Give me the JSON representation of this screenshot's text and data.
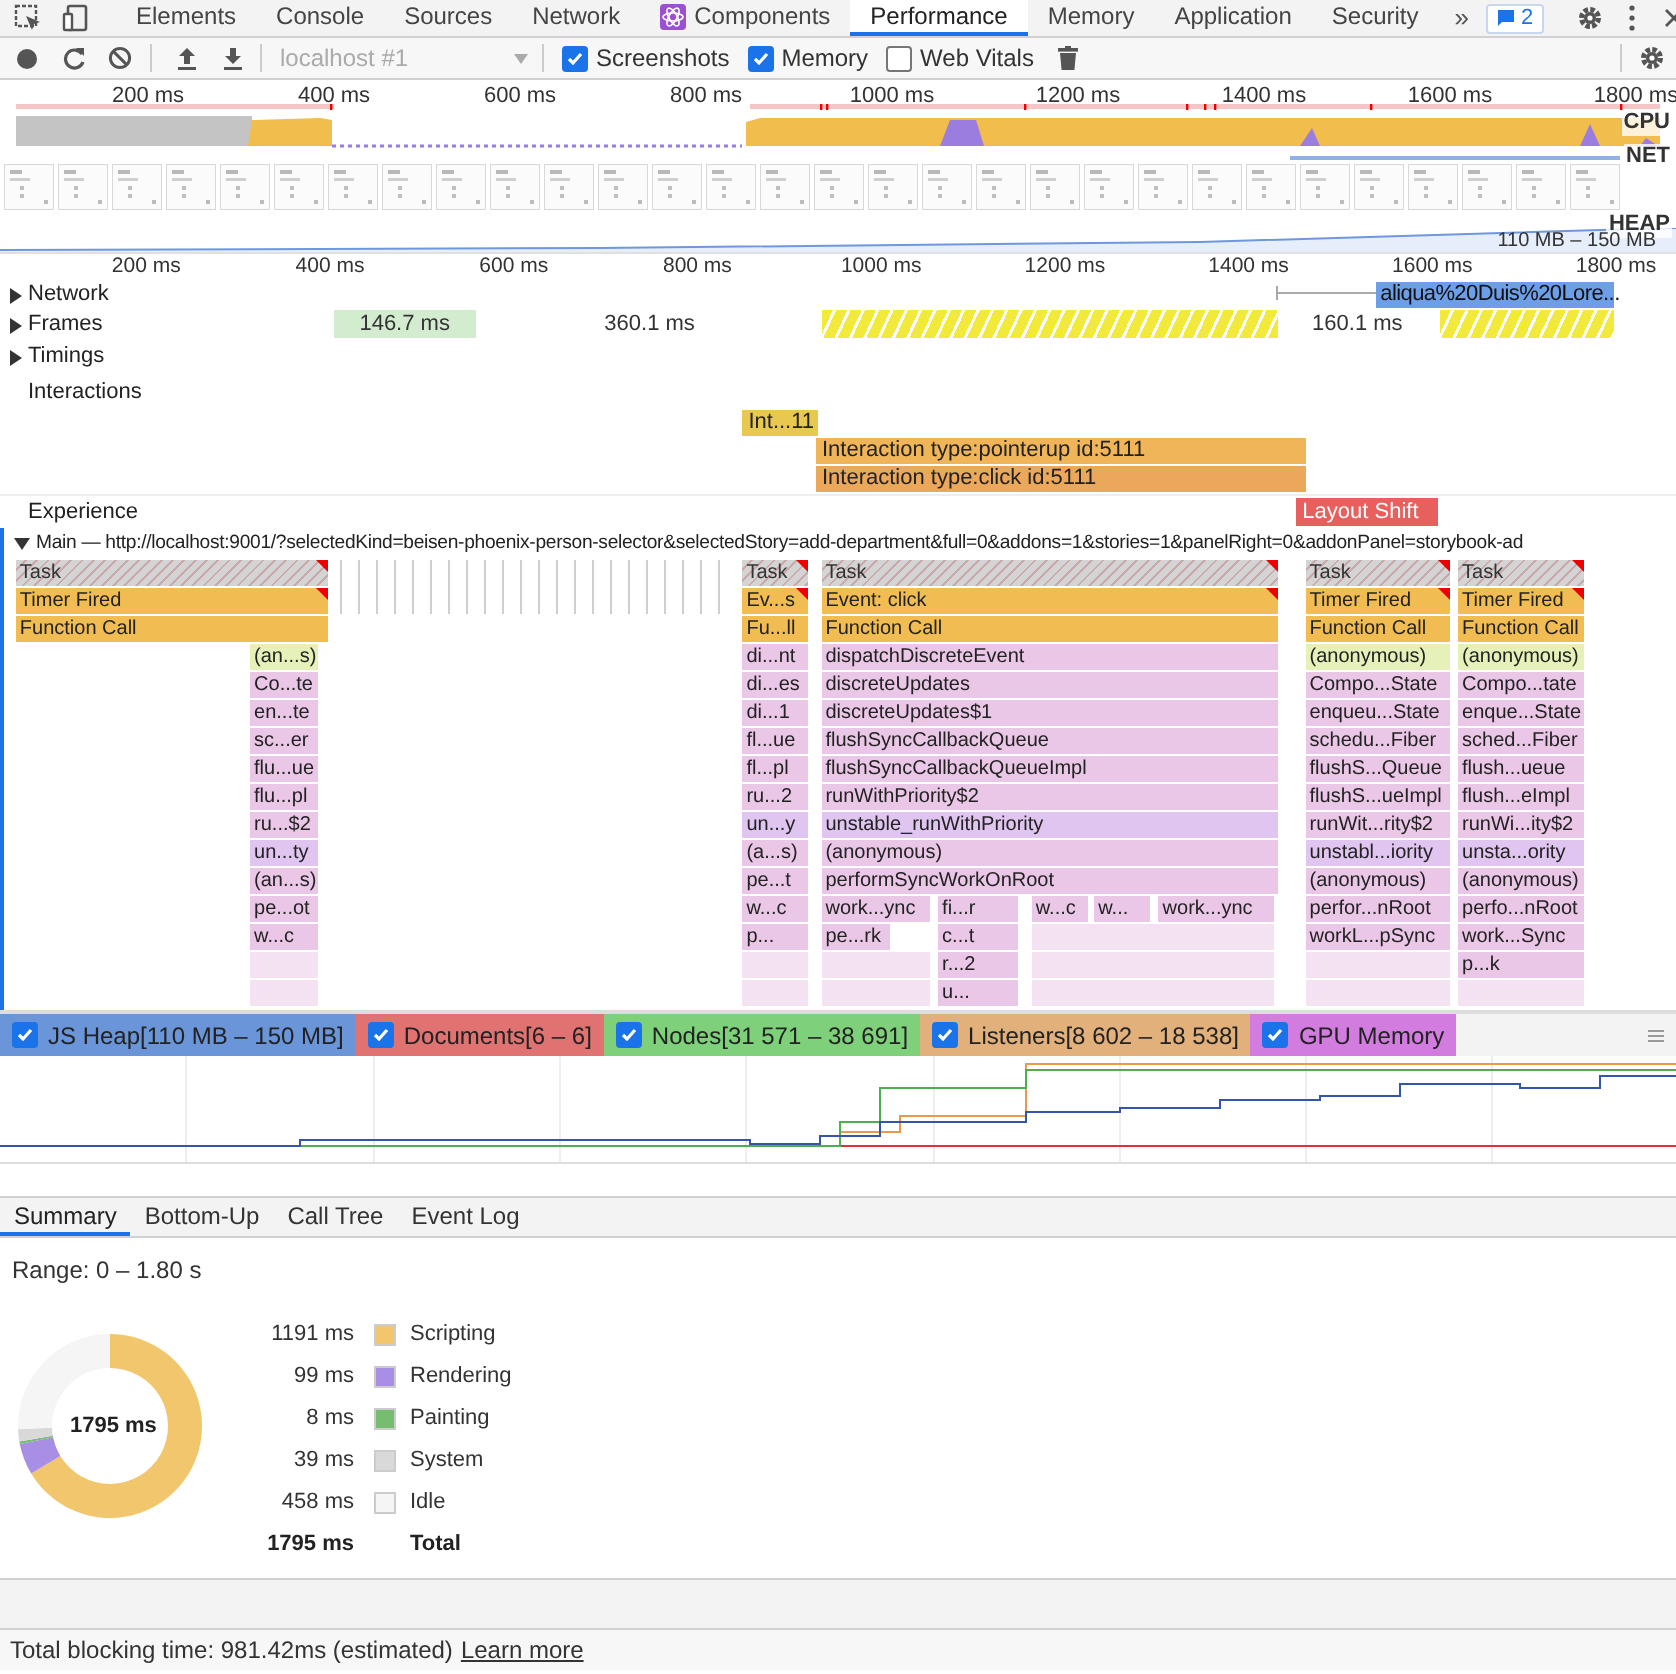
{
  "tabs": [
    {
      "label": "Elements",
      "selected": false,
      "kind": "plain"
    },
    {
      "label": "Console",
      "selected": false,
      "kind": "plain"
    },
    {
      "label": "Sources",
      "selected": false,
      "kind": "plain"
    },
    {
      "label": "Network",
      "selected": false,
      "kind": "plain"
    },
    {
      "label": "Components",
      "selected": false,
      "kind": "icon"
    },
    {
      "label": "Performance",
      "selected": true,
      "kind": "plain"
    },
    {
      "label": "Memory",
      "selected": false,
      "kind": "plain"
    },
    {
      "label": "Application",
      "selected": false,
      "kind": "plain"
    },
    {
      "label": "Security",
      "selected": false,
      "kind": "plain"
    }
  ],
  "overflow": "»",
  "issues_badge": "2",
  "toolbar": {
    "target": "localhost #1",
    "checkboxes": [
      {
        "label": "Screenshots",
        "checked": true
      },
      {
        "label": "Memory",
        "checked": true
      },
      {
        "label": "Web Vitals",
        "checked": false
      }
    ]
  },
  "overview": {
    "ticks": [
      "200 ms",
      "400 ms",
      "600 ms",
      "800 ms",
      "1000 ms",
      "1200 ms",
      "1400 ms",
      "1600 ms",
      "1800 ms"
    ],
    "lanes": [
      "CPU",
      "NET",
      "HEAP"
    ],
    "heap_range": "110 MB – 150 MB",
    "filmstrip": [
      {
        "kind": "picture"
      },
      {
        "kind": "picture"
      },
      {
        "kind": "picture"
      },
      {
        "kind": "picture"
      },
      {
        "kind": "picture"
      },
      {
        "kind": "picture"
      },
      {
        "kind": "picture"
      },
      {
        "kind": "picture"
      },
      {
        "kind": "picture"
      },
      {
        "kind": "picture"
      },
      {
        "kind": "picture"
      },
      {
        "kind": "picture"
      },
      {
        "kind": "picture"
      },
      {
        "kind": "picture"
      },
      {
        "kind": "picture"
      },
      {
        "kind": "picture"
      },
      {
        "kind": "picture"
      },
      {
        "kind": "picture"
      },
      {
        "kind": "picture"
      },
      {
        "kind": "picture"
      },
      {
        "kind": "picture"
      },
      {
        "kind": "picture"
      },
      {
        "kind": "picture"
      },
      {
        "kind": "picture"
      },
      {
        "kind": "picture"
      },
      {
        "kind": "picture"
      },
      {
        "kind": "picture"
      },
      {
        "kind": "picture"
      },
      {
        "kind": "picture"
      },
      {
        "kind": "picture"
      }
    ]
  },
  "ruler": [
    "200 ms",
    "400 ms",
    "600 ms",
    "800 ms",
    "1000 ms",
    "1200 ms",
    "1400 ms",
    "1600 ms",
    "1800 ms"
  ],
  "network": {
    "label": "Network",
    "expanded": false,
    "requests": [
      {
        "label": "aliqua%20Duis%20Lore..."
      }
    ]
  },
  "frames": {
    "label": "Frames",
    "expanded": false,
    "frames": [
      {
        "kind": "idle",
        "label": "146.7 ms"
      },
      {
        "kind": "blank",
        "label": "360.1 ms"
      },
      {
        "kind": "partial"
      },
      {
        "kind": "blank",
        "label": "160.1 ms"
      },
      {
        "kind": "partial"
      }
    ]
  },
  "timings": {
    "label": "Timings",
    "expanded": false
  },
  "interactions": {
    "label": "Interactions",
    "lanes": [
      [
        {
          "label": "Int...11",
          "color": "#e9c84f"
        }
      ],
      [
        {
          "label": "Interaction type:pointerup id:5111",
          "color": "#f0b558"
        }
      ],
      [
        {
          "label": "Interaction type:click id:5111",
          "color": "#eba75a"
        }
      ]
    ]
  },
  "experience": {
    "label": "Experience",
    "events": [
      {
        "label": "Layout Shift"
      }
    ]
  },
  "main": {
    "title": "Main — http://localhost:9001/?selectedKind=beisen-phoenix-person-selector&selectedStory=add-department&full=0&addons=1&stories=1&panelRight=0&addonPanel=storybook-ad",
    "expanded": true,
    "columns": [
      {
        "rows": [
          [
            {
              "label": "Task",
              "kind": "task",
              "warning": true
            }
          ],
          [
            {
              "label": "Timer Fired",
              "kind": "event",
              "warning": true
            }
          ],
          [
            {
              "label": "Function Call",
              "kind": "call",
              "warning": false
            }
          ],
          [
            {
              "label": "(an...s)",
              "kind": "anon"
            }
          ],
          [
            {
              "label": "Co...te",
              "kind": "js"
            }
          ],
          [
            {
              "label": "en...te",
              "kind": "js"
            }
          ],
          [
            {
              "label": "sc...er",
              "kind": "js"
            }
          ],
          [
            {
              "label": "flu...ue",
              "kind": "js"
            }
          ],
          [
            {
              "label": "flu...pl",
              "kind": "js"
            }
          ],
          [
            {
              "label": "ru...$2",
              "kind": "js"
            }
          ],
          [
            {
              "label": "un...ty",
              "kind": "sched"
            }
          ],
          [
            {
              "label": "(an...s)",
              "kind": "js"
            }
          ],
          [
            {
              "label": "pe...ot",
              "kind": "js"
            }
          ],
          [
            {
              "label": "w...c",
              "kind": "js"
            }
          ],
          [
            {
              "kind": "faint"
            }
          ],
          [
            {
              "kind": "faint"
            }
          ]
        ]
      },
      {
        "rows": [
          [
            {
              "label": "Task",
              "kind": "task",
              "warning": true
            }
          ],
          [
            {
              "label": "Ev...s",
              "kind": "event",
              "warning": true
            }
          ],
          [
            {
              "label": "Fu...ll",
              "kind": "call",
              "warning": false
            }
          ],
          [
            {
              "label": "di...nt",
              "kind": "js"
            }
          ],
          [
            {
              "label": "di...es",
              "kind": "js"
            }
          ],
          [
            {
              "label": "di...1",
              "kind": "js"
            }
          ],
          [
            {
              "label": "fl...ue",
              "kind": "js"
            }
          ],
          [
            {
              "label": "fl...pl",
              "kind": "js"
            }
          ],
          [
            {
              "label": "ru...2",
              "kind": "js"
            }
          ],
          [
            {
              "label": "un...y",
              "kind": "sched"
            }
          ],
          [
            {
              "label": "(a...s)",
              "kind": "js"
            }
          ],
          [
            {
              "label": "pe...t",
              "kind": "js"
            }
          ],
          [
            {
              "label": "w...c",
              "kind": "js"
            }
          ],
          [
            {
              "label": "p...",
              "kind": "js"
            }
          ],
          [
            {
              "kind": "faint"
            }
          ],
          [
            {
              "kind": "faint"
            }
          ]
        ]
      },
      {
        "rows": [
          [
            {
              "label": "Task",
              "kind": "task",
              "warning": true
            }
          ],
          [
            {
              "label": "Event: click",
              "kind": "event",
              "warning": true
            }
          ],
          [
            {
              "label": "Function Call",
              "kind": "call",
              "warning": false
            }
          ],
          [
            {
              "label": "dispatchDiscreteEvent",
              "kind": "js"
            }
          ],
          [
            {
              "label": "discreteUpdates",
              "kind": "js"
            }
          ],
          [
            {
              "label": "discreteUpdates$1",
              "kind": "js"
            }
          ],
          [
            {
              "label": "flushSyncCallbackQueue",
              "kind": "js"
            }
          ],
          [
            {
              "label": "flushSyncCallbackQueueImpl",
              "kind": "js"
            }
          ],
          [
            {
              "label": "runWithPriority$2",
              "kind": "js"
            }
          ],
          [
            {
              "label": "unstable_runWithPriority",
              "kind": "sched"
            }
          ],
          [
            {
              "label": "(anonymous)",
              "kind": "js"
            }
          ],
          [
            {
              "label": "performSyncWorkOnRoot",
              "kind": "js"
            }
          ],
          [
            {
              "label": "work...ync",
              "kind": "js"
            },
            {
              "label": "fi...r",
              "kind": "js"
            },
            {
              "label": "w...c",
              "kind": "js"
            },
            {
              "label": "w...",
              "kind": "js"
            },
            {
              "label": "work...ync",
              "kind": "js"
            }
          ],
          [
            {
              "label": "pe...rk",
              "kind": "js"
            },
            {
              "label": "c...t",
              "kind": "js"
            },
            {
              "kind": "faint"
            }
          ],
          [
            {
              "kind": "faint"
            },
            {
              "label": "r...2",
              "kind": "js"
            },
            {
              "kind": "faint"
            }
          ],
          [
            {
              "kind": "faint"
            },
            {
              "label": "u...",
              "kind": "js"
            },
            {
              "kind": "faint"
            }
          ]
        ]
      },
      {
        "rows": [
          [
            {
              "label": "Task",
              "kind": "task",
              "warning": true
            }
          ],
          [
            {
              "label": "Timer Fired",
              "kind": "event",
              "warning": true
            }
          ],
          [
            {
              "label": "Function Call",
              "kind": "call",
              "warning": false
            }
          ],
          [
            {
              "label": "(anonymous)",
              "kind": "anon"
            }
          ],
          [
            {
              "label": "Compo...State",
              "kind": "js"
            }
          ],
          [
            {
              "label": "enqueu...State",
              "kind": "js"
            }
          ],
          [
            {
              "label": "schedu...Fiber",
              "kind": "js"
            }
          ],
          [
            {
              "label": "flushS...Queue",
              "kind": "js"
            }
          ],
          [
            {
              "label": "flushS...ueImpl",
              "kind": "js"
            }
          ],
          [
            {
              "label": "runWit...rity$2",
              "kind": "js"
            }
          ],
          [
            {
              "label": "unstabl...iority",
              "kind": "sched"
            }
          ],
          [
            {
              "label": "(anonymous)",
              "kind": "js"
            }
          ],
          [
            {
              "label": "perfor...nRoot",
              "kind": "js"
            }
          ],
          [
            {
              "label": "workL...pSync",
              "kind": "js"
            }
          ],
          [
            {
              "kind": "faint"
            }
          ],
          [
            {
              "kind": "faint"
            }
          ]
        ]
      },
      {
        "rows": [
          [
            {
              "label": "Task",
              "kind": "task",
              "warning": true
            }
          ],
          [
            {
              "label": "Timer Fired",
              "kind": "event",
              "warning": true
            }
          ],
          [
            {
              "label": "Function Call",
              "kind": "call",
              "warning": false
            }
          ],
          [
            {
              "label": "(anonymous)",
              "kind": "anon"
            }
          ],
          [
            {
              "label": "Compo...tate",
              "kind": "js"
            }
          ],
          [
            {
              "label": "enque...State",
              "kind": "js"
            }
          ],
          [
            {
              "label": "sched...Fiber",
              "kind": "js"
            }
          ],
          [
            {
              "label": "flush...ueue",
              "kind": "js"
            }
          ],
          [
            {
              "label": "flush...eImpl",
              "kind": "js"
            }
          ],
          [
            {
              "label": "runWi...ity$2",
              "kind": "js"
            }
          ],
          [
            {
              "label": "unsta...ority",
              "kind": "sched"
            }
          ],
          [
            {
              "label": "(anonymous)",
              "kind": "js"
            }
          ],
          [
            {
              "label": "perfo...nRoot",
              "kind": "js"
            }
          ],
          [
            {
              "label": "work...Sync",
              "kind": "js"
            }
          ],
          [
            {
              "label": "p...k",
              "kind": "js"
            }
          ],
          [
            {
              "kind": "faint"
            }
          ]
        ]
      }
    ]
  },
  "counters": [
    {
      "label": "JS Heap[110 MB – 150 MB]",
      "checked": true,
      "color": "#6a95d8"
    },
    {
      "label": "Documents[6 – 6]",
      "checked": true,
      "color": "#e07272"
    },
    {
      "label": "Nodes[31 571 – 38 691]",
      "checked": true,
      "color": "#7ed07a"
    },
    {
      "label": "Listeners[8 602 – 18 538]",
      "checked": true,
      "color": "#e2b07a"
    },
    {
      "label": "GPU Memory",
      "checked": true,
      "color": "#d27ce0"
    }
  ],
  "details": {
    "tabs": [
      {
        "label": "Summary",
        "selected": true
      },
      {
        "label": "Bottom-Up",
        "selected": false
      },
      {
        "label": "Call Tree",
        "selected": false
      },
      {
        "label": "Event Log",
        "selected": false
      }
    ],
    "range": "Range: 0 – 1.80 s",
    "center_label": "1795 ms",
    "items": [
      {
        "value": "1191 ms",
        "color": "#f2c66c"
      },
      {
        "value": "99 ms",
        "color": "#a98ee6"
      },
      {
        "value": "8 ms",
        "color": "#77bd6f"
      },
      {
        "value": "39 ms",
        "color": "#d9d9d9"
      },
      {
        "value": "458 ms",
        "color": "#f5f5f5"
      }
    ],
    "total": {
      "value": "1795 ms",
      "label": "Total"
    },
    "chart_data": {
      "type": "donut",
      "categories": [
        "Scripting",
        "Rendering",
        "Painting",
        "System",
        "Idle"
      ],
      "values": [
        66.35,
        5.52,
        0.45,
        2.17,
        25.51
      ]
    }
  },
  "footer": {
    "text": "Total blocking time: 981.42ms (estimated)",
    "link": "Learn more"
  }
}
